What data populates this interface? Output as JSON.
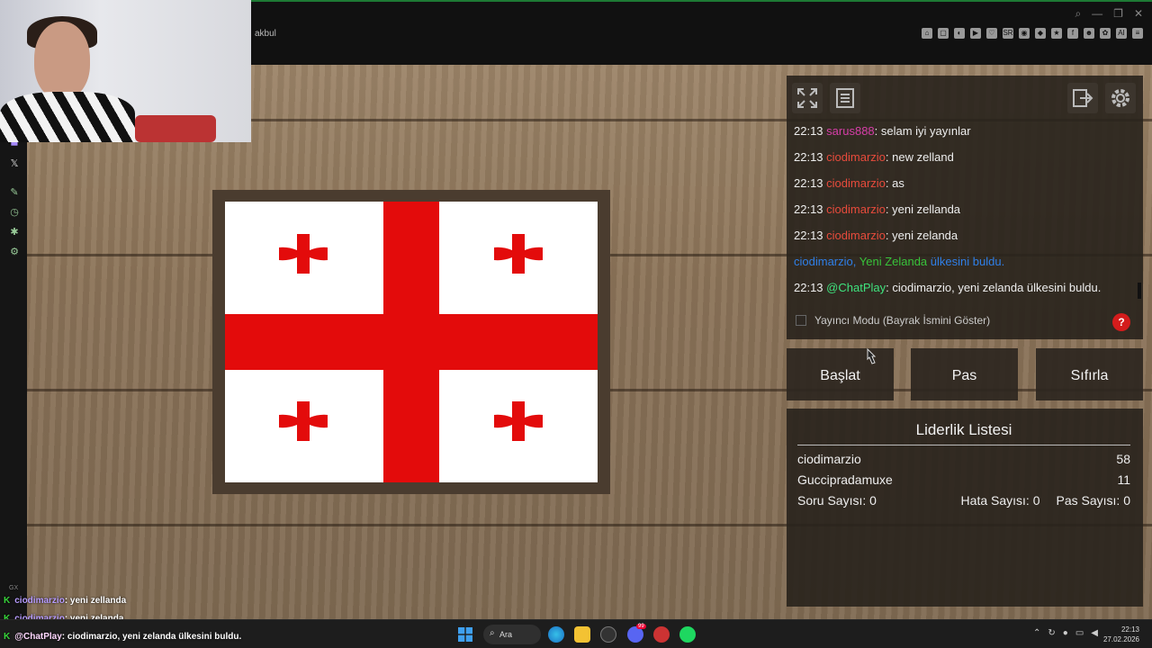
{
  "browser": {
    "tab_title": "akbul",
    "window_controls": [
      "⌕",
      "—",
      "❐",
      "✕"
    ],
    "extensions": [
      "⌂",
      "▢",
      "◐",
      "▶",
      "♡",
      "SR",
      "◉",
      "◆",
      "★",
      "f",
      "☻",
      "✿",
      "AI",
      "≡"
    ]
  },
  "sidebar": {
    "icons": [
      "twitch-icon",
      "x-icon",
      "link-icon",
      "clock-icon",
      "settings-icon"
    ]
  },
  "chat": {
    "lines": [
      {
        "time": "22:13",
        "user": "sarus888",
        "color_class": "chat-user-1",
        "text": ": selam iyi yayınlar"
      },
      {
        "time": "22:13",
        "user": "ciodimarzio",
        "color_class": "chat-user-2",
        "text": ": new zelland"
      },
      {
        "time": "22:13",
        "user": "ciodimarzio",
        "color_class": "chat-user-2",
        "text": ": as"
      },
      {
        "time": "22:13",
        "user": "ciodimarzio",
        "color_class": "chat-user-2",
        "text": ": yeni zellanda"
      },
      {
        "time": "22:13",
        "user": "ciodimarzio",
        "color_class": "chat-user-2",
        "text": ": yeni zelanda"
      }
    ],
    "found_line": {
      "user": "ciodimarzio,",
      "country": "Yeni Zelanda",
      "suffix": "ülkesini buldu."
    },
    "bot_line": {
      "time": "22:13",
      "user": "@ChatPlay",
      "text": ": ciodimarzio, yeni zelanda ülkesini buldu."
    },
    "streamer_mode_label": "Yayıncı Modu (Bayrak İsmini Göster)",
    "help_label": "?"
  },
  "buttons": {
    "start": "Başlat",
    "pass": "Pas",
    "reset": "Sıfırla"
  },
  "leaderboard": {
    "title": "Liderlik Listesi",
    "rows": [
      {
        "name": "ciodimarzio",
        "score": "58"
      },
      {
        "name": "Guccipradamuxe",
        "score": "11"
      }
    ],
    "stats": {
      "questions_label": "Soru Sayısı:",
      "questions_value": "0",
      "errors_label": "Hata Sayısı:",
      "errors_value": "0",
      "passes_label": "Pas Sayısı:",
      "passes_value": "0"
    }
  },
  "overlay": {
    "lines": [
      {
        "user": "ciodimarzio",
        "text": ": yeni zellanda"
      },
      {
        "user": "ciodimarzio",
        "text": ": yeni zelanda"
      },
      {
        "user": "@ChatPlay",
        "text": ": ciodimarzio, yeni zelanda ülkesini buldu."
      }
    ],
    "tag": "GX"
  },
  "taskbar": {
    "search_label": "Ara",
    "time": "22:13",
    "date": "27.02.2026",
    "discord_badge": "99"
  },
  "colors": {
    "flag_red": "#e30b0b",
    "flag_white": "#ffffff",
    "accent_green": "#37d63a"
  }
}
